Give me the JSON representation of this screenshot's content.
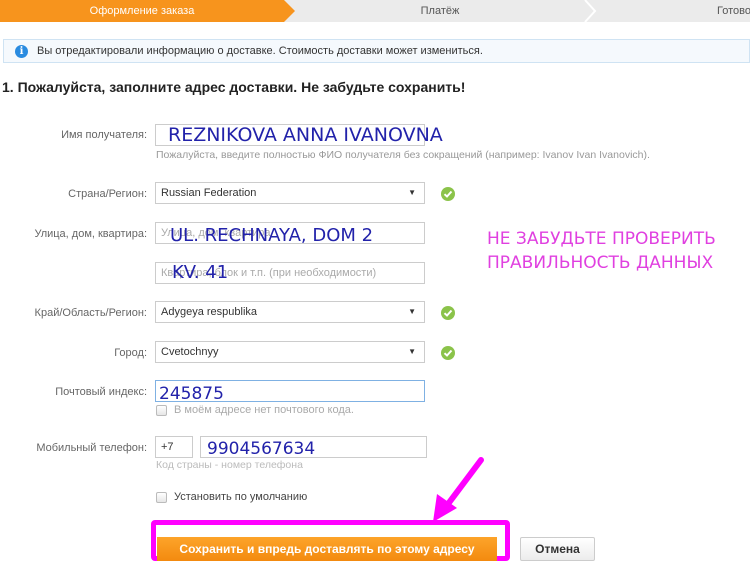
{
  "steps": [
    {
      "label": "Оформление заказа",
      "active": true
    },
    {
      "label": "Платёж",
      "active": false
    },
    {
      "label": "Готово",
      "active": false
    }
  ],
  "info": {
    "icon": "info-icon",
    "text": "Вы отредактировали информацию о доставке. Стоимость доставки может измениться."
  },
  "title": "1. Пожалуйста, заполните адрес доставки. Не забудьте сохранить!",
  "form": {
    "recipient": {
      "label": "Имя получателя:",
      "value": "REZNIKOVA ANNA IVANOVNA",
      "hint": "Пожалуйста, введите полностью ФИО получателя без сокращений (например: Ivanov Ivan Ivanovich)."
    },
    "country": {
      "label": "Страна/Регион:",
      "value": "Russian Federation",
      "valid": true
    },
    "street": {
      "label": "Улица, дом, квартира:",
      "placeholder": "Улица, дом, квартира",
      "value": "UL. RECHNAYA, DOM 2"
    },
    "street2": {
      "placeholder": "Квартира, блок и т.п. (при необходимости)",
      "value": "KV. 41"
    },
    "region": {
      "label": "Край/Область/Регион:",
      "value": "Adygeya respublika",
      "valid": true
    },
    "city": {
      "label": "Город:",
      "value": "Cvetochnyy",
      "valid": true
    },
    "postal": {
      "label": "Почтовый индекс:",
      "value": "245875",
      "no_code_label": "В моём адресе нет почтового кода.",
      "no_code_checked": false
    },
    "phone": {
      "label": "Мобильный телефон:",
      "country_code": "+7",
      "value": "9904567634",
      "hint": "Код страны - номер телефона"
    },
    "default": {
      "label": "Установить по умолчанию",
      "checked": false
    }
  },
  "annotation": {
    "line1": "НЕ ЗАБУДЬТЕ ПРОВЕРИТЬ",
    "line2": "ПРАВИЛЬНОСТЬ ДАННЫХ",
    "color": "#e040e0",
    "highlight_color": "#ff00ff"
  },
  "buttons": {
    "save": "Сохранить и впредь доставлять по этому адресу",
    "cancel": "Отмена"
  },
  "colors": {
    "accent": "#f7941d",
    "valid": "#8bc34a",
    "info": "#2a8be0"
  }
}
